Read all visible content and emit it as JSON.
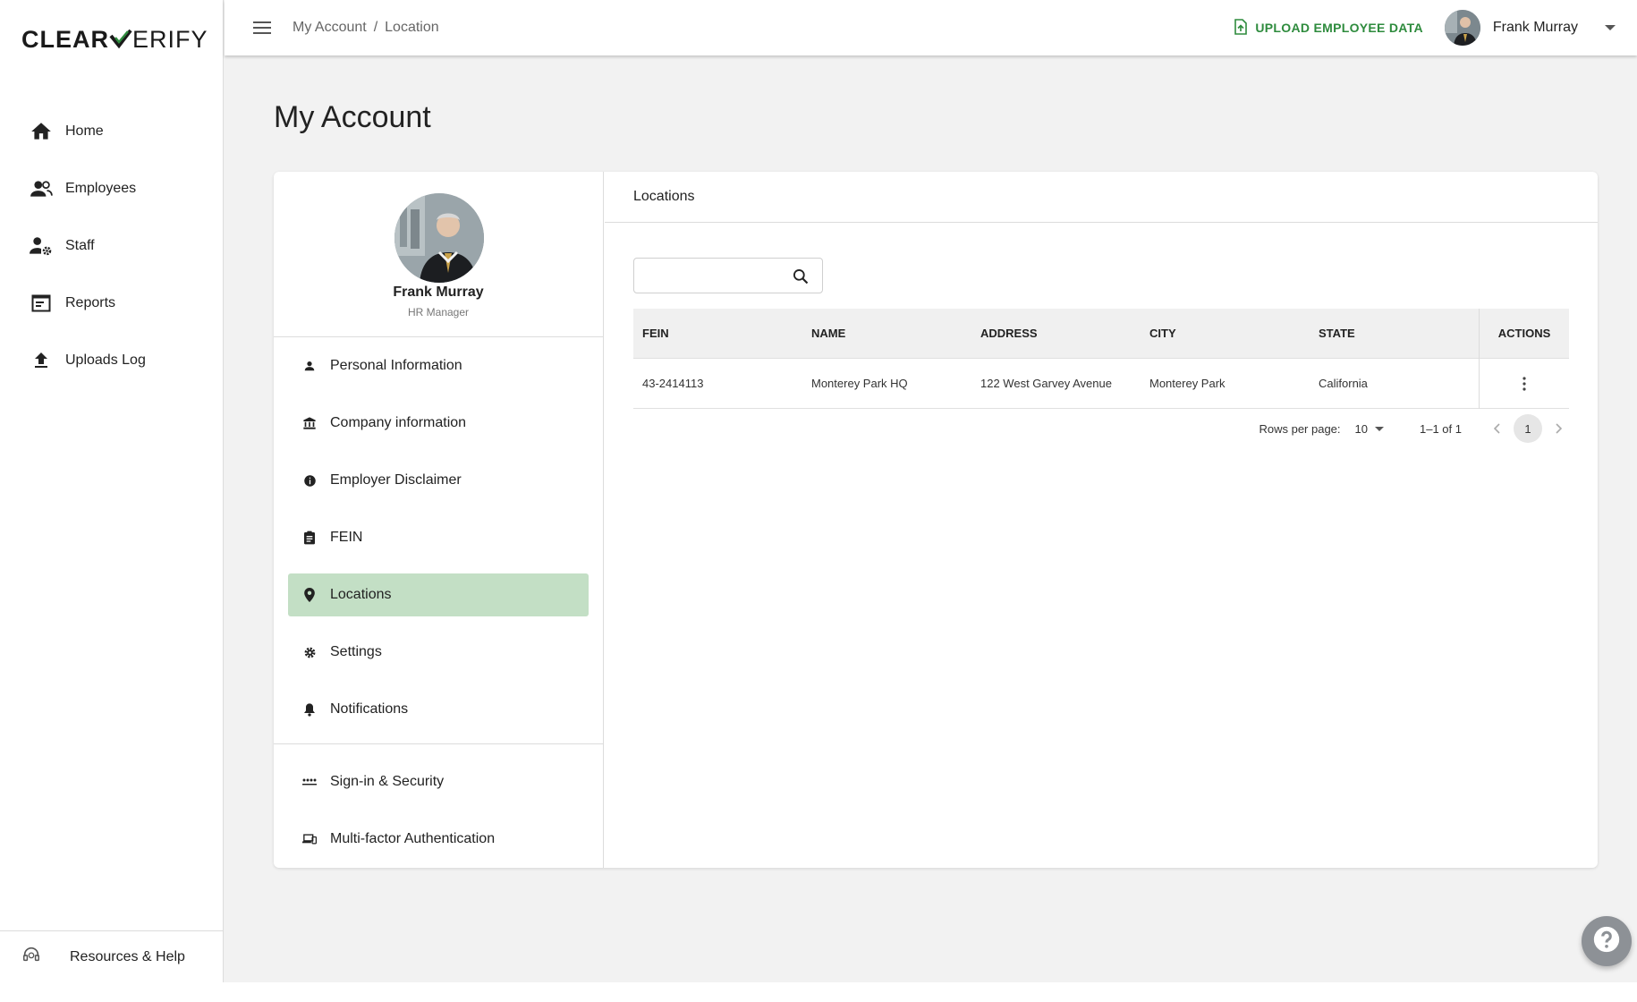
{
  "brand": {
    "logo_text_left": "CLEAR",
    "logo_text_right": "ERIFY",
    "accent": "#2e8b3d"
  },
  "sidebar": {
    "items": [
      {
        "label": "Home",
        "icon": "home-icon"
      },
      {
        "label": "Employees",
        "icon": "people-icon"
      },
      {
        "label": "Staff",
        "icon": "staff-settings-icon"
      },
      {
        "label": "Reports",
        "icon": "reports-icon"
      },
      {
        "label": "Uploads Log",
        "icon": "upload-icon"
      }
    ],
    "footer_label": "Resources & Help"
  },
  "topbar": {
    "breadcrumb": [
      "My Account",
      "/",
      "Location"
    ],
    "upload_label": "UPLOAD EMPLOYEE DATA",
    "user_name": "Frank Murray"
  },
  "page": {
    "title": "My Account"
  },
  "profile": {
    "name": "Frank Murray",
    "role": "HR Manager"
  },
  "account_menu": {
    "items": [
      {
        "label": "Personal Information",
        "icon": "person-icon"
      },
      {
        "label": "Company information",
        "icon": "bank-icon"
      },
      {
        "label": "Employer Disclaimer",
        "icon": "info-icon"
      },
      {
        "label": "FEIN",
        "icon": "clipboard-icon"
      },
      {
        "label": "Locations",
        "icon": "location-pin-icon",
        "active": true
      },
      {
        "label": "Settings",
        "icon": "gear-icon"
      },
      {
        "label": "Notifications",
        "icon": "bell-icon"
      }
    ],
    "security_items": [
      {
        "label": "Sign-in & Security",
        "icon": "password-icon"
      },
      {
        "label": "Multi-factor Authentication",
        "icon": "devices-icon"
      }
    ],
    "active_color": "#c3dfc5"
  },
  "locations": {
    "header": "Locations",
    "search": {
      "value": "",
      "placeholder": ""
    },
    "columns": [
      "FEIN",
      "NAME",
      "ADDRESS",
      "CITY",
      "STATE",
      "ACTIONS"
    ],
    "rows": [
      {
        "fein": "43-2414113",
        "name": "Monterey Park HQ",
        "address": "122 West Garvey Avenue",
        "city": "Monterey Park",
        "state": "California"
      }
    ],
    "pagination": {
      "rows_label": "Rows per page:",
      "rows_value": "10",
      "range": "1–1 of 1",
      "page": "1"
    }
  }
}
